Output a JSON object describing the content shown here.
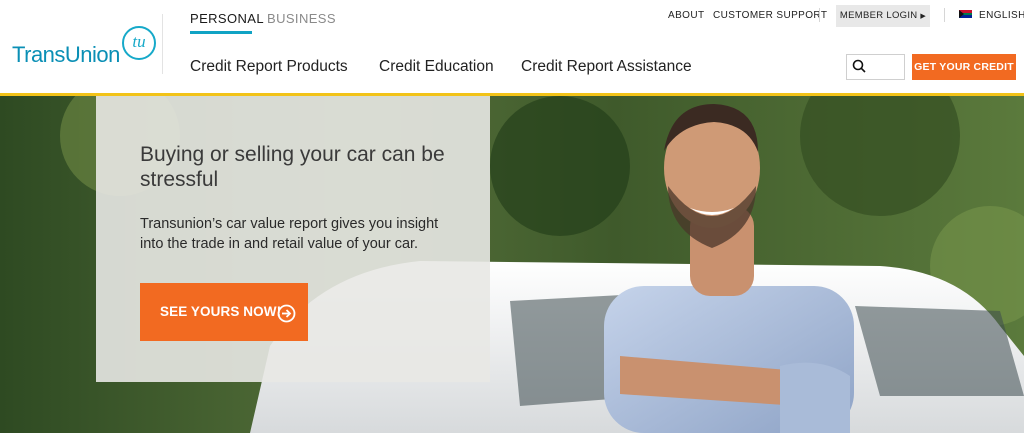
{
  "brand": {
    "logo_text": "TransUnion",
    "logo_mark": "tu",
    "color": "#0a8fb5",
    "icon": "transunion-logo"
  },
  "tabs": [
    {
      "label": "PERSONAL",
      "active": true
    },
    {
      "label": "BUSINESS",
      "active": false
    }
  ],
  "nav": [
    {
      "label": "Credit Report Products"
    },
    {
      "label": "Credit Education"
    },
    {
      "label": "Credit Report Assistance"
    }
  ],
  "utility": {
    "about": "ABOUT",
    "support": "CUSTOMER SUPPORT",
    "member_login": "MEMBER LOGIN",
    "member_login_icon": "triangle-right-icon",
    "language": "ENGLISH",
    "language_flag": "south-africa-flag-icon"
  },
  "search": {
    "placeholder": "",
    "icon": "search-icon"
  },
  "cta_header": {
    "label": "GET YOUR CREDIT",
    "color": "#f26a21"
  },
  "hero": {
    "title": "Buying or selling your car can be stressful",
    "body": "Transunion’s car value report gives you insight into the trade in and retail value of your car.",
    "button_label": "SEE YOURS NOW!",
    "button_icon": "arrow-circle-right-icon",
    "accent_color": "#f2c318",
    "image": "smiling-man-with-white-car-photo"
  }
}
